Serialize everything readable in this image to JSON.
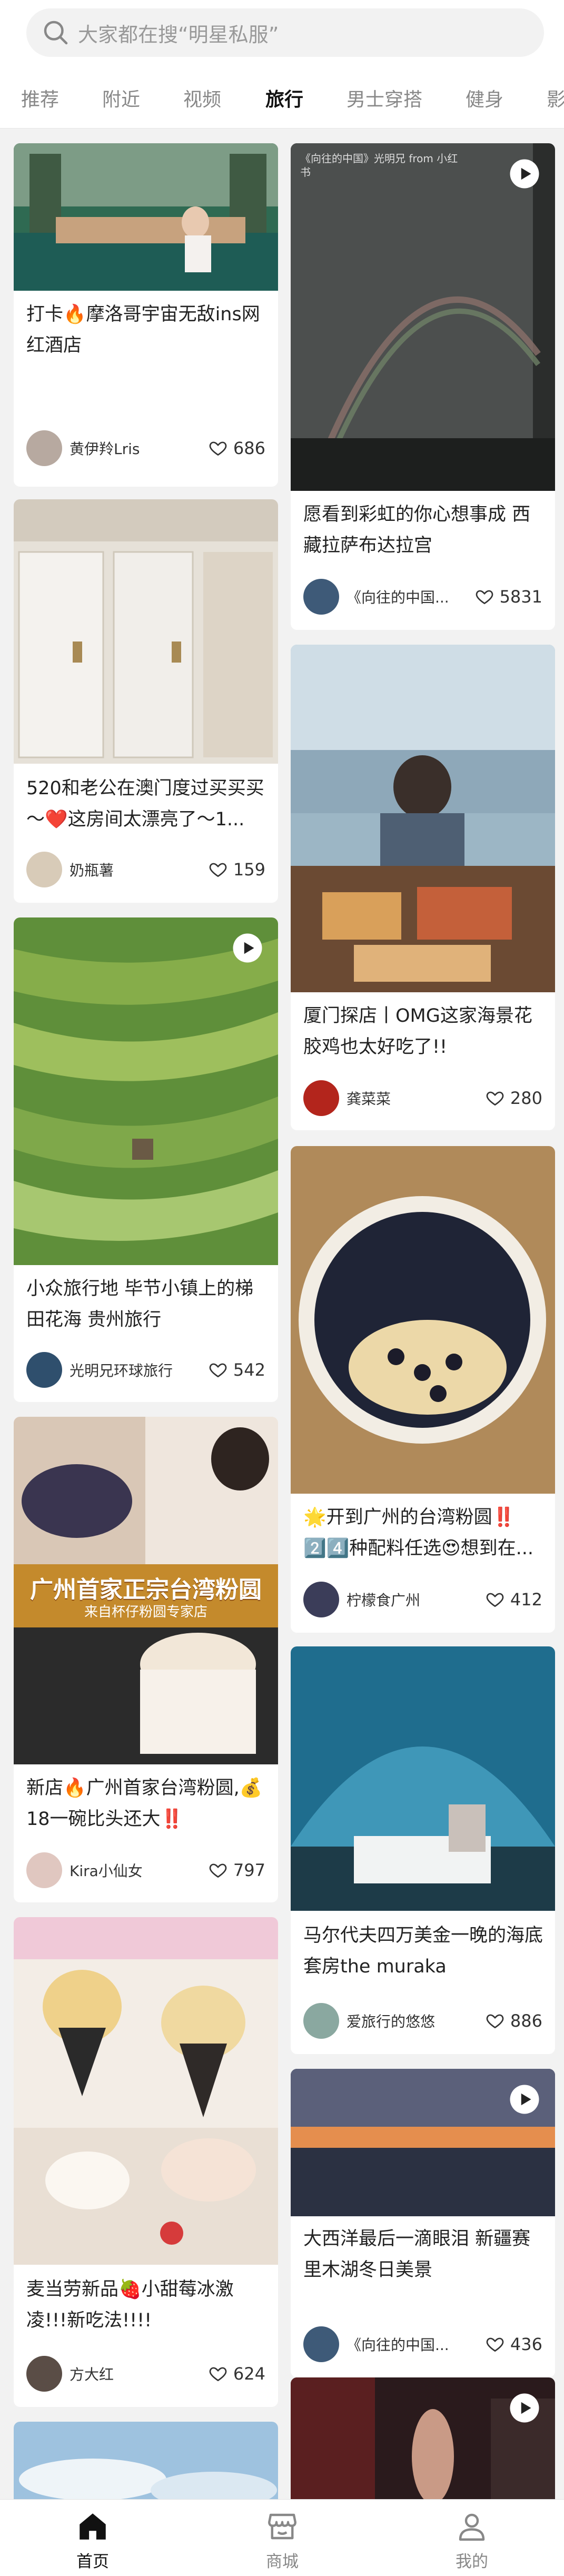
{
  "search": {
    "placeholder": "大家都在搜“明星私服”"
  },
  "tabs": [
    "推荐",
    "附近",
    "视频",
    "旅行",
    "男士穿搭",
    "健身",
    "影"
  ],
  "active_tab": "旅行",
  "cards": [
    {
      "title": "打卡🔥摩洛哥宇宙无敌ins网红酒店",
      "author": "黄伊羚Lris",
      "likes": "686",
      "watermark": ""
    },
    {
      "title": "愿看到彩虹的你心想事成 西藏拉萨布达拉宫",
      "author": "《向往的中国...",
      "likes": "5831",
      "watermark": "《向往的中国》光明兄 from 小红书"
    },
    {
      "title": "520和老公在澳门度过买买买～❤️这房间太漂亮了～1...",
      "author": "奶瓶薯",
      "likes": "159",
      "watermark": ""
    },
    {
      "title": "厦门探店丨OMG这家海景花胶鸡也太好吃了!!",
      "author": "龚菜菜",
      "likes": "280",
      "watermark": ""
    },
    {
      "title": "小众旅行地 毕节小镇上的梯田花海 贵州旅行",
      "author": "光明兄环球旅行",
      "likes": "542",
      "watermark": "光明兄环球旅行"
    },
    {
      "title": "🌟开到广州的台湾粉圆‼️2️⃣4️⃣种配料任选😍想到在...",
      "author": "柠檬食广州",
      "likes": "412",
      "watermark": ""
    },
    {
      "title": "新店🔥广州首家台湾粉圆,💰18一碗比头还大‼️",
      "author": "Kira小仙女",
      "likes": "797",
      "watermark": "",
      "banner": "广州首家正宗台湾粉圆",
      "banner_sub": "来自杯仔粉圆专家店"
    },
    {
      "title": "马尔代夫四万美金一晚的海底套房the muraka",
      "author": "爱旅行的悠悠",
      "likes": "886",
      "watermark": ""
    },
    {
      "title": "麦当劳新品🍓小甜莓冰激凌!!!新吃法!!!!",
      "author": "方大红",
      "likes": "624",
      "watermark": ""
    },
    {
      "title": "大西洋最后一滴眼泪 新疆赛里木湖冬日美景",
      "author": "《向往的中国...",
      "likes": "436",
      "watermark": ""
    }
  ],
  "bottom_nav": [
    {
      "label": "首页",
      "active": true
    },
    {
      "label": "商城",
      "active": false
    },
    {
      "label": "我的",
      "active": false
    }
  ],
  "colors": {
    "background": "#f2f2f2",
    "card": "#ffffff",
    "text": "#222222",
    "muted": "#888888"
  }
}
